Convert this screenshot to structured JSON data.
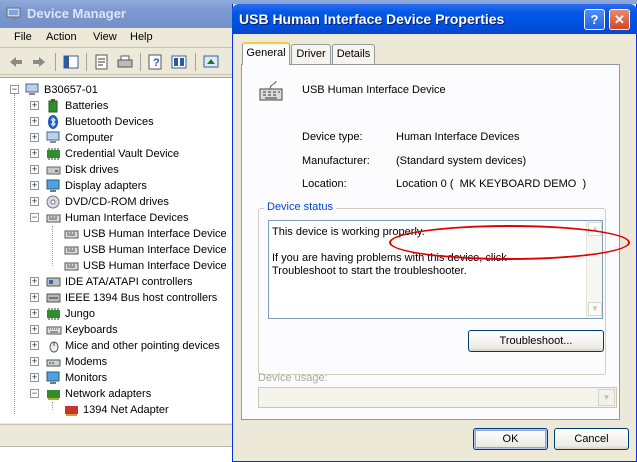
{
  "device_manager": {
    "title": "Device Manager",
    "menu": [
      "File",
      "Action",
      "View",
      "Help"
    ],
    "toolbar_icons": [
      "back-arrow-icon",
      "forward-arrow-icon",
      "show-hide-tree-icon",
      "properties-icon",
      "print-icon",
      "help-icon",
      "view-icon",
      "update-driver-icon"
    ],
    "tree": {
      "root": "B30657-01",
      "items": [
        {
          "label": "Batteries",
          "icon": "battery-icon",
          "expanded": false
        },
        {
          "label": "Bluetooth Devices",
          "icon": "bluetooth-icon",
          "expanded": false
        },
        {
          "label": "Computer",
          "icon": "computer-icon",
          "expanded": false
        },
        {
          "label": "Credential Vault Device",
          "icon": "chip-icon",
          "expanded": false
        },
        {
          "label": "Disk drives",
          "icon": "disk-drive-icon",
          "expanded": false
        },
        {
          "label": "Display adapters",
          "icon": "display-adapter-icon",
          "expanded": false
        },
        {
          "label": "DVD/CD-ROM drives",
          "icon": "cdrom-icon",
          "expanded": false
        },
        {
          "label": "Human Interface Devices",
          "icon": "hid-icon",
          "expanded": true,
          "children": [
            "USB Human Interface Device",
            "USB Human Interface Device",
            "USB Human Interface Device"
          ]
        },
        {
          "label": "IDE ATA/ATAPI controllers",
          "icon": "ide-controller-icon",
          "expanded": false
        },
        {
          "label": "IEEE 1394 Bus host controllers",
          "icon": "ieee1394-icon",
          "expanded": false
        },
        {
          "label": "Jungo",
          "icon": "chip-icon",
          "expanded": false
        },
        {
          "label": "Keyboards",
          "icon": "keyboard-icon",
          "expanded": false
        },
        {
          "label": "Mice and other pointing devices",
          "icon": "mouse-icon",
          "expanded": false
        },
        {
          "label": "Modems",
          "icon": "modem-icon",
          "expanded": false
        },
        {
          "label": "Monitors",
          "icon": "monitor-icon",
          "expanded": false
        },
        {
          "label": "Network adapters",
          "icon": "network-adapter-icon",
          "expanded": true,
          "children": [
            "1394 Net Adapter"
          ]
        }
      ]
    }
  },
  "properties_dialog": {
    "title": "USB Human Interface Device Properties",
    "help_button": "?",
    "close_button": "✕",
    "tabs": [
      "General",
      "Driver",
      "Details"
    ],
    "active_tab": "General",
    "device_name": "USB Human Interface Device",
    "fields": [
      {
        "label": "Device type:",
        "value": "Human Interface Devices"
      },
      {
        "label": "Manufacturer:",
        "value": "(Standard system devices)"
      },
      {
        "label": "Location:",
        "value": "Location 0 (  MK KEYBOARD DEMO  )"
      }
    ],
    "device_status": {
      "label": "Device status",
      "line1": "This device is working properly.",
      "line2": "If you are having problems with this device, click Troubleshoot to start the troubleshooter."
    },
    "troubleshoot_button": "Troubleshoot...",
    "device_usage_label": "Device usage:",
    "ok_button": "OK",
    "cancel_button": "Cancel",
    "highlight_color": "#e00000"
  },
  "colors": {
    "dialog_title_blue": "#0058e6",
    "inactive_title_blue": "#7c98cf",
    "group_label_blue": "#0046d5"
  }
}
